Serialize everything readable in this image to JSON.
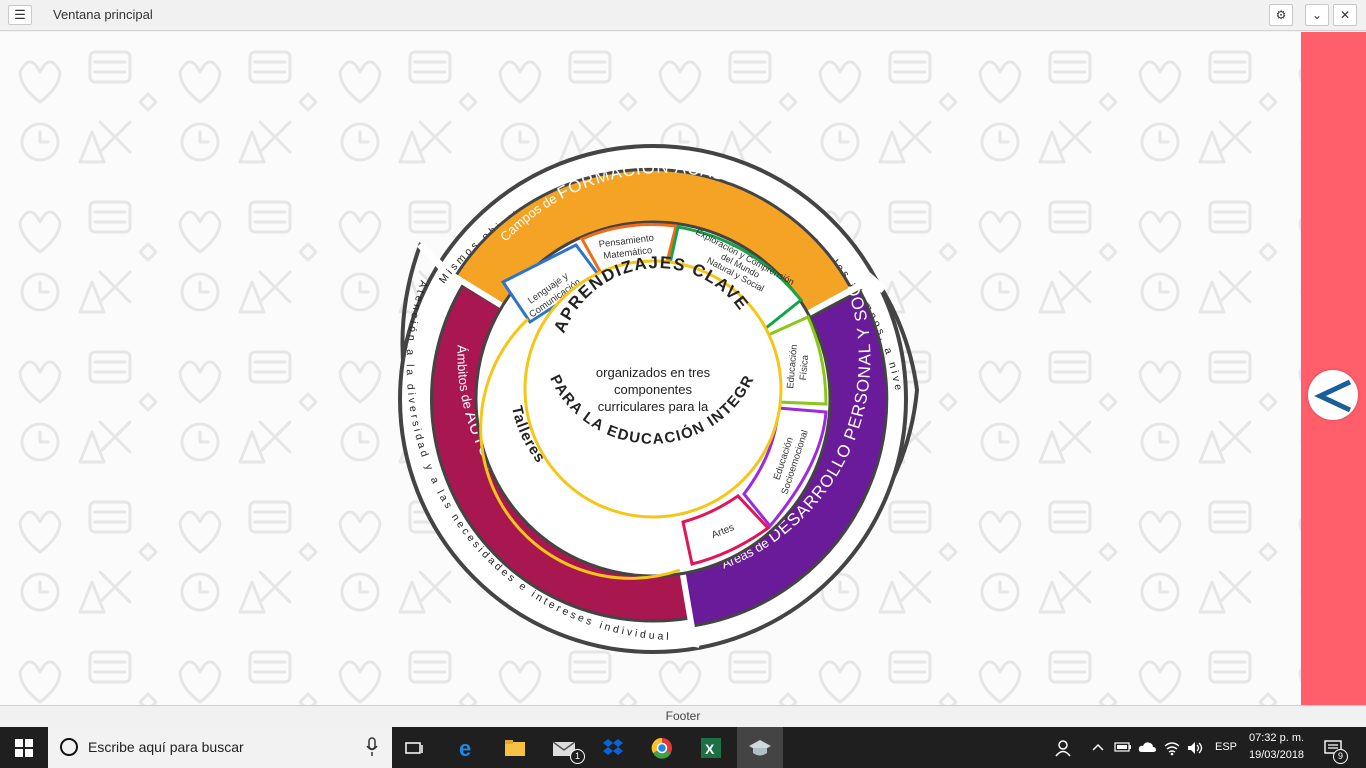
{
  "window": {
    "title": "Ventana principal",
    "footer": "Footer"
  },
  "diagram": {
    "outer_top_arc": "Mismos objetivos curriculares y horas lectivas para todos los alumnos, a nivel nacional",
    "outer_left_arc": "Atención a la diversidad y a las necesidades e intereses individuales",
    "academic": {
      "prefix": "Campos de ",
      "title": "FORMACIÓN ACADÉMICA",
      "color": "#f4a324"
    },
    "autonomy": {
      "prefix": "Ámbitos de ",
      "title": "AUTONOMÍA CURRICULAR",
      "color": "#a8174f"
    },
    "personal": {
      "prefix": "Áreas de ",
      "title": "DESARROLLO PERSONAL Y SOCIAL",
      "color": "#6a1b9a"
    },
    "boxes": {
      "lenguaje": "Lenguaje y Comunicación",
      "pensamiento": "Pensamiento Matemático",
      "exploracion": "Exploración y Comprensión del Mundo Natural y Social",
      "educacion_fisica": "Educación Física",
      "socioemocional": "Educación Socioemocional",
      "artes": "Artes"
    },
    "talleres": "Talleres",
    "center": {
      "top_arc": "APRENDIZAJES CLAVE",
      "line1": "organizados en tres",
      "line2": "componentes",
      "line3": "curriculares para la",
      "bottom_arc": "PARA LA EDUCACIÓN INTEGRAL"
    }
  },
  "taskbar": {
    "search_placeholder": "Escribe aquí para buscar",
    "mail_badge": "1",
    "language": "ESP",
    "time": "07:32 p. m.",
    "date": "19/03/2018",
    "notifications": "9"
  },
  "colors": {
    "accent_side": "#ff5e6a",
    "lenguaje": "#2e74c9",
    "pensamiento": "#f06c1b",
    "exploracion": "#16a34a",
    "fisica": "#8bc71a",
    "socioemocional": "#9b2bdc",
    "artes": "#e21558",
    "talleres": "#f5c518"
  }
}
